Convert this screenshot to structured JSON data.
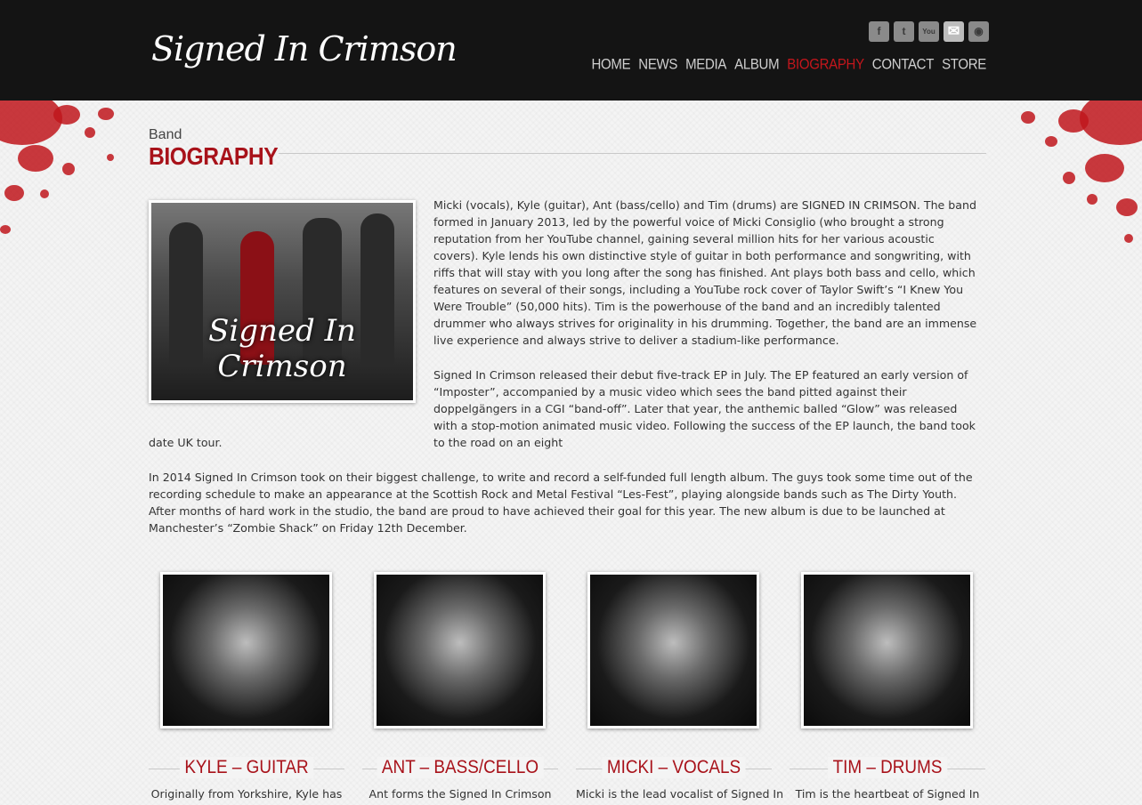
{
  "header": {
    "logo_text": "Signed In Crimson",
    "social": [
      {
        "icon": "facebook-icon",
        "glyph": "f"
      },
      {
        "icon": "twitter-icon",
        "glyph": "t"
      },
      {
        "icon": "youtube-icon",
        "glyph": "You"
      },
      {
        "icon": "email-icon",
        "glyph": "✉"
      },
      {
        "icon": "rss-icon",
        "glyph": "◉"
      }
    ],
    "nav": [
      {
        "label": "HOME",
        "active": false
      },
      {
        "label": "NEWS",
        "active": false
      },
      {
        "label": "MEDIA",
        "active": false
      },
      {
        "label": "ALBUM",
        "active": false
      },
      {
        "label": "BIOGRAPHY",
        "active": true
      },
      {
        "label": "CONTACT",
        "active": false
      },
      {
        "label": "STORE",
        "active": false
      }
    ]
  },
  "colors": {
    "accent": "#a8121a",
    "header_bg": "#141414"
  },
  "page": {
    "band_label": "Band",
    "title": "BIOGRAPHY",
    "photo_logo": "Signed In Crimson",
    "para1": "Micki (vocals), Kyle (guitar), Ant (bass/cello) and Tim (drums) are SIGNED IN CRIMSON. The band formed in January 2013, led by the powerful voice of Micki Consiglio (who brought a strong reputation from her YouTube channel, gaining several million hits for her various acoustic covers). Kyle lends his own distinctive style of guitar in both performance and songwriting, with riffs that will stay with you long after the song has finished. Ant plays both bass and cello, which features on several of their songs, including a YouTube rock cover of Taylor Swift’s “I Knew You Were Trouble” (50,000 hits). Tim is the powerhouse of the band and an incredibly talented drummer who always strives for originality in his drumming. Together, the band are an immense live experience and always strive to deliver a stadium-like performance.",
    "para2a": "Signed In Crimson released their debut five-track EP in July. The EP featured an early version of “Imposter”, accompanied by a music video which sees the band pitted against their doppelgängers in a CGI “band-off”. Later that year, the anthemic balled “Glow” was released with a stop-motion animated music video. Following the success of the EP launch, the band took to the road on an eight",
    "para2b": "date UK tour.",
    "para3": "In 2014 Signed In Crimson took on their biggest challenge, to write and record a self-funded full length album. The guys took some time out of the recording schedule to make an appearance at the Scottish Rock and Metal Festival “Les-Fest”, playing alongside bands such as The Dirty Youth. After months of hard work in the studio, the band are proud to have achieved their goal for this year. The new album is due to be launched at Manchester’s “Zombie Shack” on Friday 12th December."
  },
  "members": [
    {
      "name": "KYLE – GUITAR",
      "desc": "Originally from Yorkshire, Kyle has"
    },
    {
      "name": "ANT – BASS/CELLO",
      "desc": "Ant forms the Signed In Crimson"
    },
    {
      "name": "MICKI – VOCALS",
      "desc": "Micki is the lead vocalist of Signed In"
    },
    {
      "name": "TIM – DRUMS",
      "desc": "Tim is the heartbeat of Signed In"
    }
  ]
}
